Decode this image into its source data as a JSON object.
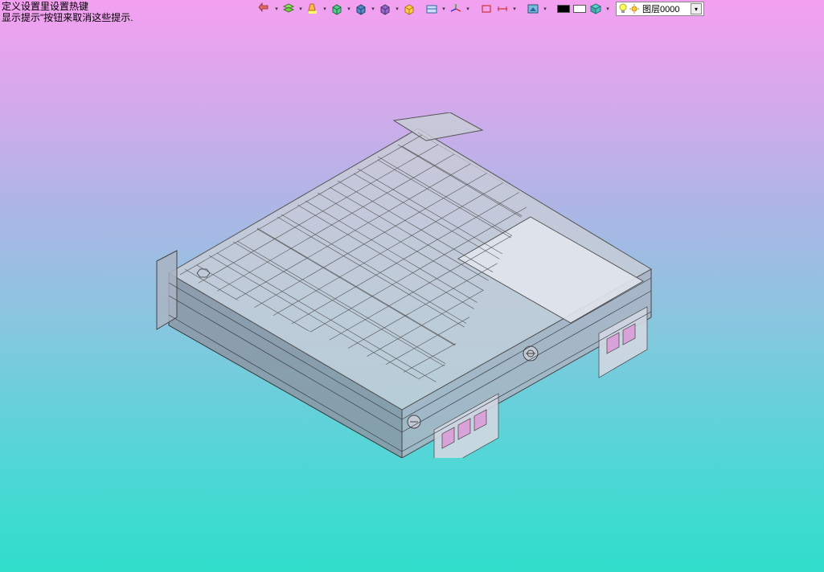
{
  "hints": {
    "line1": "定义设置里设置热键",
    "line2": "显示提示\"按钮来取消这些提示."
  },
  "toolbar": {
    "icons": {
      "undo": "undo-icon",
      "layers": "layers-icon",
      "highlighter": "highlighter-icon",
      "box1": "box-green-icon",
      "box2": "box-blue-icon",
      "box3": "box-purple-icon",
      "isoview": "iso-cube-icon",
      "section": "section-icon",
      "axis": "axis-icon",
      "rect": "rectangle-icon",
      "measure": "measure-icon",
      "render": "render-style-icon"
    },
    "swatch_black": "#000000",
    "swatch_white": "#ffffff",
    "material": "material-icon"
  },
  "layer": {
    "name": "图层0000"
  },
  "colors": {
    "model_body": "#c8cdd7",
    "model_dark": "#8c96a5",
    "port_accent": "#d9a2d9"
  }
}
